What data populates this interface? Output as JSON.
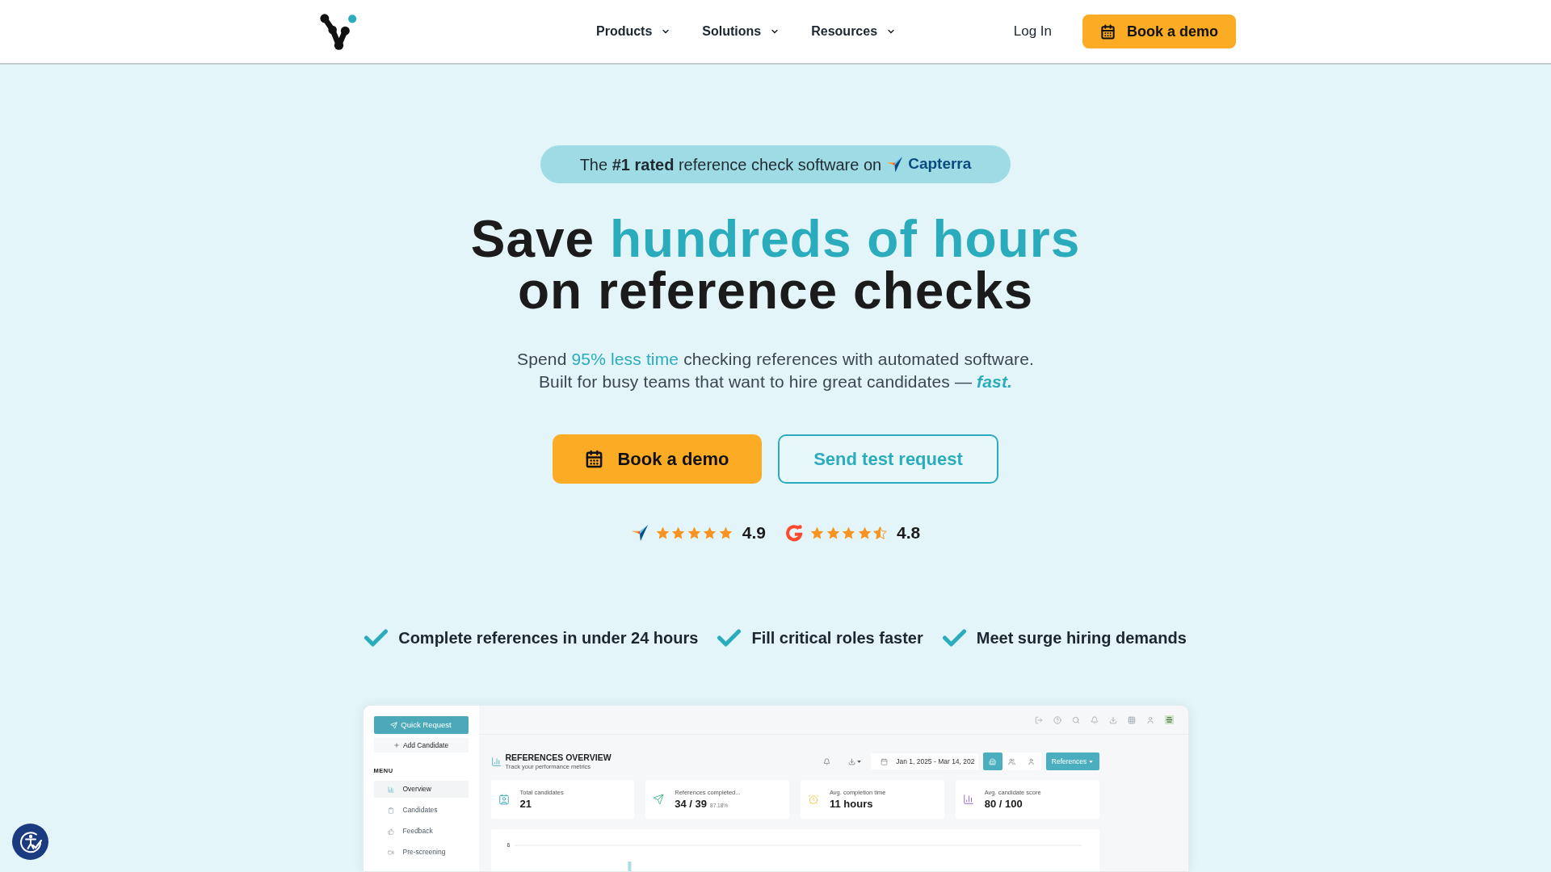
{
  "header": {
    "nav": [
      {
        "label": "Products"
      },
      {
        "label": "Solutions"
      },
      {
        "label": "Resources"
      }
    ],
    "login": "Log In",
    "cta": "Book a demo"
  },
  "hero": {
    "badge": {
      "text": "The **#1 rated** reference check software on",
      "brand": "Capterra"
    },
    "title": [
      [
        {
          "text": "Save ",
          "kind": "plain"
        },
        {
          "text": "hundreds of hours",
          "kind": "accent"
        }
      ],
      [
        {
          "text": "on reference checks",
          "kind": "plain"
        }
      ]
    ],
    "subtitle": [
      [
        {
          "text": "Spend ",
          "kind": "plain"
        },
        {
          "text": "95% less time",
          "kind": "accent"
        },
        {
          "text": " checking references with automated software.",
          "kind": "plain"
        }
      ],
      [
        {
          "text": "Built for busy teams that want to hire great candidates — ",
          "kind": "plain"
        },
        {
          "text": "fast.",
          "kind": "emphasis"
        }
      ]
    ],
    "buttons": [
      {
        "label": "Book a demo",
        "kind": "primary"
      },
      {
        "label": "Send test request",
        "kind": "outline"
      }
    ],
    "ratings": [
      {
        "kind": "arrow",
        "stars": 5,
        "score": "4.9"
      },
      {
        "kind": "ring",
        "stars": 4.5,
        "score": "4.8"
      }
    ]
  },
  "benefits": [
    "Complete references in under 24 hours",
    "Fill critical roles faster",
    "Meet surge hiring demands"
  ],
  "dashboard": {
    "sidebar": {
      "quick_request": "Quick Request",
      "add_candidate": "Add Candidate",
      "menu_title": "MENU",
      "items": [
        {
          "label": "Overview",
          "selected": true
        },
        {
          "label": "Candidates",
          "selected": false
        },
        {
          "label": "Feedback",
          "selected": false
        },
        {
          "label": "Pre-screening",
          "selected": false
        }
      ]
    },
    "title": "REFERENCES OVERVIEW",
    "subtitle": "Track your performance metrics",
    "date_range": "Jan 1, 2025 - Mar 14, 202",
    "view_toggle": [
      {
        "selected": true
      },
      {
        "selected": false
      },
      {
        "selected": false
      }
    ],
    "filter": "References",
    "stats": [
      {
        "kind": "candidates",
        "label": "Total candidates",
        "value": "21"
      },
      {
        "kind": "references",
        "label": "References completed...",
        "value": "34 / 39",
        "note": "87.18%"
      },
      {
        "kind": "time",
        "label": "Avg. completion time",
        "value": "11 hours"
      },
      {
        "kind": "score",
        "label": "Avg. candidate score",
        "value": "80 / 100"
      }
    ],
    "chart": {
      "y_tick": "6"
    }
  }
}
